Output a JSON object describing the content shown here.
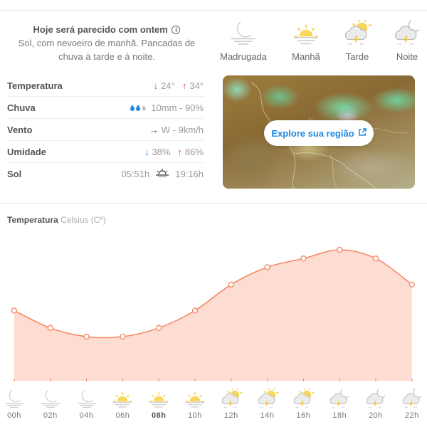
{
  "summary": {
    "title": "Hoje será parecido com ontem",
    "info_icon": "info-icon",
    "description": "Sol, com nevoeiro de manhã. Pancadas de chuva à tarde e à noite."
  },
  "periods": [
    {
      "label": "Madrugada",
      "icon": "moon-fog-icon"
    },
    {
      "label": "Manhã",
      "icon": "sun-fog-icon"
    },
    {
      "label": "Tarde",
      "icon": "sun-cloud-storm-icon"
    },
    {
      "label": "Noite",
      "icon": "moon-cloud-storm-icon"
    }
  ],
  "stats": {
    "temperature": {
      "label": "Temperatura",
      "min": "24°",
      "max": "34°"
    },
    "rain": {
      "label": "Chuva",
      "value": "10mm - 90%",
      "drops_filled": 2,
      "drops_total": 3
    },
    "wind": {
      "label": "Vento",
      "value": "W - 9km/h"
    },
    "humidity": {
      "label": "Umidade",
      "min": "38%",
      "max": "86%"
    },
    "sun": {
      "label": "Sol",
      "sunrise": "05:51h",
      "sunset": "19:16h"
    }
  },
  "map": {
    "button_label": "Explore sua região"
  },
  "chart_section": {
    "title": "Temperatura",
    "unit": "Celsius (Cº)"
  },
  "colors": {
    "line": "#f4845f",
    "fill": "#fddcd2",
    "blue": "#1e88e5",
    "red": "#e53935",
    "sun": "#f9d65c"
  },
  "chart_data": {
    "type": "area",
    "title": "Temperatura Celsius (Cº)",
    "xlabel": "",
    "ylabel": "",
    "x": [
      "00h",
      "02h",
      "04h",
      "06h",
      "08h",
      "10h",
      "12h",
      "14h",
      "16h",
      "18h",
      "20h",
      "22h"
    ],
    "values": [
      27,
      25,
      24,
      24,
      25,
      27,
      30,
      32,
      33,
      34,
      33,
      30
    ],
    "ylim": [
      15,
      35
    ],
    "grid": false
  },
  "hours": [
    {
      "label": "00h",
      "icon": "moon-fog-icon"
    },
    {
      "label": "02h",
      "icon": "moon-fog-icon"
    },
    {
      "label": "04h",
      "icon": "moon-fog-icon"
    },
    {
      "label": "06h",
      "icon": "sun-fog-icon"
    },
    {
      "label": "08h",
      "icon": "sun-fog-icon",
      "current": true
    },
    {
      "label": "10h",
      "icon": "sun-fog-icon"
    },
    {
      "label": "12h",
      "icon": "sun-cloud-storm-icon"
    },
    {
      "label": "14h",
      "icon": "sun-cloud-storm-icon"
    },
    {
      "label": "16h",
      "icon": "sun-cloud-storm-icon"
    },
    {
      "label": "18h",
      "icon": "moon-cloud-storm-icon"
    },
    {
      "label": "20h",
      "icon": "moon-cloud-storm-icon"
    },
    {
      "label": "22h",
      "icon": "moon-cloud-storm-icon"
    }
  ]
}
